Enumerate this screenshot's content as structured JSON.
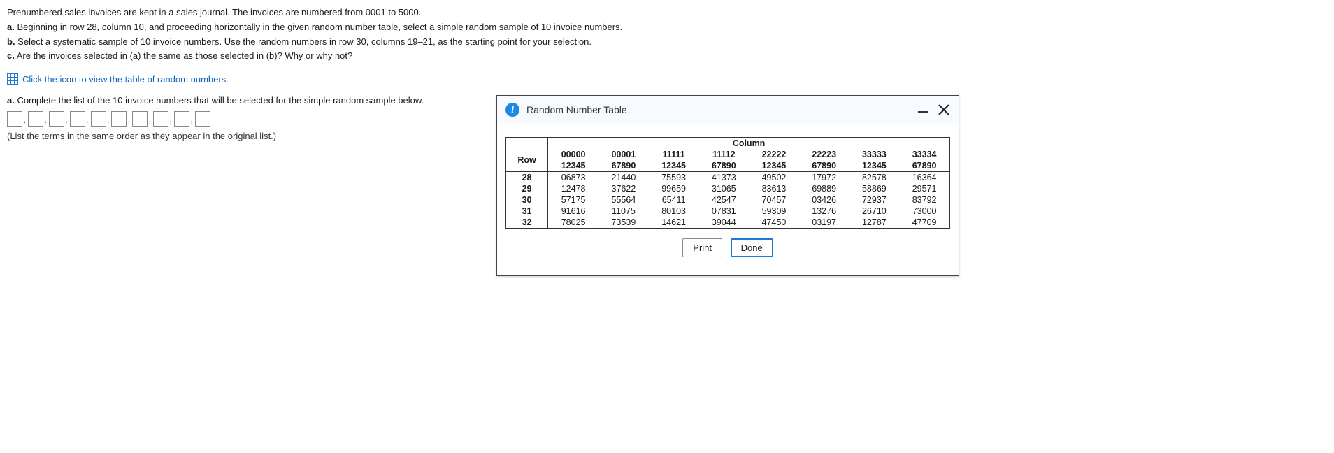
{
  "intro": {
    "line1": "Prenumbered sales invoices are kept in a sales journal. The invoices are numbered from 0001 to 5000.",
    "a_label": "a.",
    "a_text": " Beginning in row 28, column 10, and proceeding horizontally in the given random number table, select a simple random sample of 10 invoice numbers.",
    "b_label": "b.",
    "b_text": " Select a systematic sample of 10 invoice numbers. Use the random numbers in row 30, columns 19–21, as the starting point for your selection.",
    "c_label": "c.",
    "c_text": " Are the invoices selected in (a) the same as those selected in (b)? Why or why not?",
    "link": "Click the icon to view the table of random numbers."
  },
  "part_a": {
    "label": "a.",
    "prompt": " Complete the list of the 10 invoice numbers that will be selected for the simple random sample below.",
    "hint": "(List the terms in the same order as they appear in the original list.)"
  },
  "dialog": {
    "title": "Random Number Table",
    "print": "Print",
    "done": "Done"
  },
  "table": {
    "column_heading": "Column",
    "row_heading": "Row",
    "col_header_top": [
      "00000",
      "00001",
      "11111",
      "11112",
      "22222",
      "22223",
      "33333",
      "33334"
    ],
    "col_header_bottom": [
      "12345",
      "67890",
      "12345",
      "67890",
      "12345",
      "67890",
      "12345",
      "67890"
    ],
    "rows": [
      {
        "label": "28",
        "cells": [
          "06873",
          "21440",
          "75593",
          "41373",
          "49502",
          "17972",
          "82578",
          "16364"
        ]
      },
      {
        "label": "29",
        "cells": [
          "12478",
          "37622",
          "99659",
          "31065",
          "83613",
          "69889",
          "58869",
          "29571"
        ]
      },
      {
        "label": "30",
        "cells": [
          "57175",
          "55564",
          "65411",
          "42547",
          "70457",
          "03426",
          "72937",
          "83792"
        ]
      },
      {
        "label": "31",
        "cells": [
          "91616",
          "11075",
          "80103",
          "07831",
          "59309",
          "13276",
          "26710",
          "73000"
        ]
      },
      {
        "label": "32",
        "cells": [
          "78025",
          "73539",
          "14621",
          "39044",
          "47450",
          "03197",
          "12787",
          "47709"
        ]
      }
    ]
  }
}
